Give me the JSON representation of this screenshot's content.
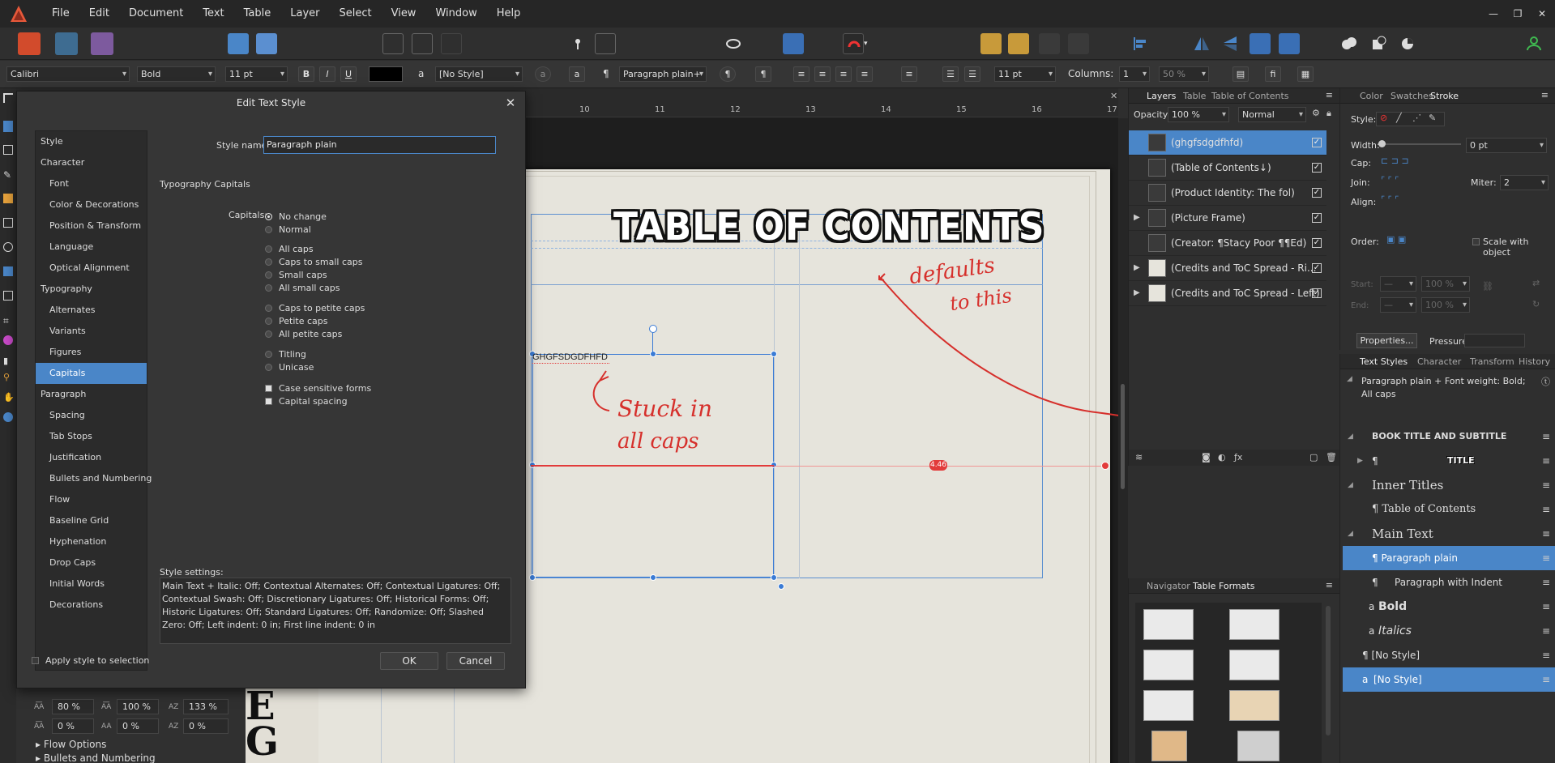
{
  "menubar": {
    "items": [
      "File",
      "Edit",
      "Document",
      "Text",
      "Table",
      "Layer",
      "Select",
      "View",
      "Window",
      "Help"
    ]
  },
  "context_bar": {
    "font": "Calibri",
    "weight": "Bold",
    "size": "11 pt",
    "bold": "B",
    "italic": "I",
    "underline": "U",
    "char_style": "[No Style]",
    "char_style_icon": "a",
    "para_style": "Paragraph plain+",
    "pilcrow": "¶",
    "leading": "11 pt",
    "columns_label": "Columns:",
    "columns_value": "1",
    "percent": "50 %",
    "fi": "fi"
  },
  "ruler": {
    "numbers": [
      "10",
      "11",
      "12",
      "13",
      "14",
      "15",
      "16",
      "17"
    ]
  },
  "canvas": {
    "title": "TABLE OF CONTENTS",
    "frame_text": "GHGFSDGDFHFD",
    "annotation_1_line1": "defaults",
    "annotation_1_line2": "to this",
    "annotation_2_line1": "Stuck in",
    "annotation_2_line2": "all caps",
    "dimension": "4.46"
  },
  "dialog": {
    "title": "Edit Text Style",
    "style_name_label": "Style name:",
    "style_name_value": "Paragraph plain",
    "section_heading": "Typography Capitals",
    "capitals_label": "Capitals:",
    "nav": [
      {
        "label": "Style",
        "sub": false,
        "sel": false
      },
      {
        "label": "Character",
        "sub": false,
        "sel": false
      },
      {
        "label": "Font",
        "sub": true,
        "sel": false
      },
      {
        "label": "Color & Decorations",
        "sub": true,
        "sel": false
      },
      {
        "label": "Position & Transform",
        "sub": true,
        "sel": false
      },
      {
        "label": "Language",
        "sub": true,
        "sel": false
      },
      {
        "label": "Optical Alignment",
        "sub": true,
        "sel": false
      },
      {
        "label": "Typography",
        "sub": false,
        "sel": false
      },
      {
        "label": "Alternates",
        "sub": true,
        "sel": false
      },
      {
        "label": "Variants",
        "sub": true,
        "sel": false
      },
      {
        "label": "Figures",
        "sub": true,
        "sel": false
      },
      {
        "label": "Capitals",
        "sub": true,
        "sel": true
      },
      {
        "label": "Paragraph",
        "sub": false,
        "sel": false
      },
      {
        "label": "Spacing",
        "sub": true,
        "sel": false
      },
      {
        "label": "Tab Stops",
        "sub": true,
        "sel": false
      },
      {
        "label": "Justification",
        "sub": true,
        "sel": false
      },
      {
        "label": "Bullets and Numbering",
        "sub": true,
        "sel": false
      },
      {
        "label": "Flow",
        "sub": true,
        "sel": false
      },
      {
        "label": "Baseline Grid",
        "sub": true,
        "sel": false
      },
      {
        "label": "Hyphenation",
        "sub": true,
        "sel": false
      },
      {
        "label": "Drop Caps",
        "sub": true,
        "sel": false
      },
      {
        "label": "Initial Words",
        "sub": true,
        "sel": false
      },
      {
        "label": "Decorations",
        "sub": true,
        "sel": false
      }
    ],
    "radios": [
      {
        "label": "No change",
        "on": true
      },
      {
        "label": "Normal",
        "on": false
      },
      {
        "label": "All caps",
        "on": false
      },
      {
        "label": "Caps to small caps",
        "on": false
      },
      {
        "label": "Small caps",
        "on": false
      },
      {
        "label": "All small caps",
        "on": false
      },
      {
        "label": "Caps to petite caps",
        "on": false
      },
      {
        "label": "Petite caps",
        "on": false
      },
      {
        "label": "All petite caps",
        "on": false
      },
      {
        "label": "Titling",
        "on": false
      },
      {
        "label": "Unicase",
        "on": false
      }
    ],
    "checks": [
      {
        "label": "Case sensitive forms"
      },
      {
        "label": "Capital spacing"
      }
    ],
    "settings_label": "Style settings:",
    "settings_text": "Main Text + Italic: Off; Contextual Alternates: Off; Contextual Ligatures: Off; Contextual Swash: Off; Discretionary Ligatures: Off; Historical Forms: Off; Historic Ligatures: Off; Standard Ligatures: Off; Randomize: Off; Slashed Zero: Off; Left indent: 0 in; First line indent: 0 in",
    "apply_label": "Apply style to selection",
    "ok": "OK",
    "cancel": "Cancel"
  },
  "bottom_left": {
    "row1": [
      "80 %",
      "100 %",
      "133 %"
    ],
    "row2": [
      "0 %",
      "0 %",
      "0 %"
    ],
    "flow_options": "Flow Options",
    "bullets": "Bullets and Numbering"
  },
  "layers_panel": {
    "tabs": [
      "Layers",
      "Table",
      "Table of Contents"
    ],
    "opacity_label": "Opacity:",
    "opacity_value": "100 %",
    "blend": "Normal",
    "rows": [
      {
        "name": "(ghgfsdgdfhfd)",
        "sel": true
      },
      {
        "name": "(Table of Contents↓)",
        "sel": false
      },
      {
        "name": "(Product Identity: The fol)",
        "sel": false
      },
      {
        "name": "(Picture Frame)",
        "sel": false
      },
      {
        "name": "(Creator: ¶Stacy Poor ¶¶Ed)",
        "sel": false
      },
      {
        "name": "(Credits and ToC Spread - Ri...",
        "sel": false
      },
      {
        "name": "(Credits and ToC Spread - Left)",
        "sel": false
      }
    ]
  },
  "nav_panel": {
    "tabs": [
      "Navigator",
      "Table Formats"
    ]
  },
  "stroke_panel": {
    "tabs": [
      "Color",
      "Swatches",
      "Stroke"
    ],
    "style_label": "Style:",
    "width_label": "Width:",
    "width_value": "0 pt",
    "cap_label": "Cap:",
    "join_label": "Join:",
    "miter_label": "Miter:",
    "miter_value": "2",
    "align_label": "Align:",
    "order_label": "Order:",
    "scale_label": "Scale with object",
    "start_label": "Start:",
    "end_label": "End:",
    "start_pct": "100 %",
    "end_pct": "100 %",
    "properties": "Properties...",
    "pressure": "Pressure:"
  },
  "text_styles": {
    "tabs": [
      "Text Styles",
      "Character",
      "Transform",
      "History"
    ],
    "summary": "Paragraph plain + Font weight: Bold; All caps",
    "rows": [
      {
        "label": "BOOK TITLE AND SUBTITLE",
        "kind": "group",
        "sel": false
      },
      {
        "label": "TITLE",
        "kind": "title",
        "sel": false
      },
      {
        "label": "Inner Titles",
        "kind": "group",
        "sel": false
      },
      {
        "label": "¶ Table of Contents",
        "kind": "item",
        "sel": false
      },
      {
        "label": "Main Text",
        "kind": "group",
        "sel": false
      },
      {
        "label": "¶ Paragraph plain",
        "kind": "item",
        "sel": true
      },
      {
        "label": "Paragraph with Indent",
        "kind": "item2",
        "sel": false
      },
      {
        "label": "Bold",
        "kind": "bold",
        "sel": false
      },
      {
        "label": "Italics",
        "kind": "italic",
        "sel": false
      },
      {
        "label": "¶ [No Style]",
        "kind": "plain",
        "sel": false
      },
      {
        "label": "[No Style]",
        "kind": "plainsel",
        "sel": true
      }
    ],
    "pilcrow": "¶",
    "char_a": "a"
  },
  "colors": {
    "accent": "#4a86c8",
    "annotation_red": "#d6302c",
    "selection_blue": "#3a7bd5"
  }
}
